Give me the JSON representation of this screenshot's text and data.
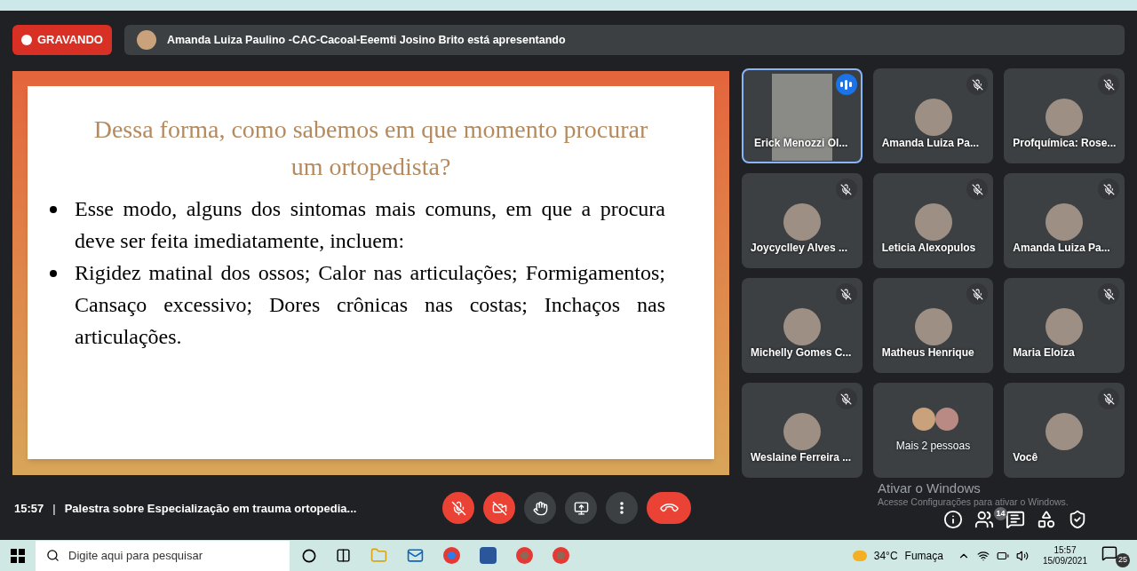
{
  "recording": {
    "label": "GRAVANDO",
    "on": true
  },
  "presenter_banner": {
    "text": "Amanda Luiza Paulino -CAC-Cacoal-Eeemti Josino Brito está apresentando"
  },
  "slide": {
    "title": "Dessa forma, como sabemos em que momento procurar um ortopedista?",
    "bullets": [
      "Esse modo, alguns dos sintomas mais comuns, em que a procura deve ser feita imediatamente, incluem:",
      "Rigidez matinal dos ossos; Calor nas articulações; Formigamentos; Cansaço excessivo; Dores crônicas nas costas; Inchaços nas articulações."
    ]
  },
  "participants": [
    {
      "kind": "video",
      "name": "Erick Menozzi Ol...",
      "speaking": true,
      "muted": false
    },
    {
      "kind": "avatar",
      "name": "Amanda Luiza Pa...",
      "speaking": false,
      "muted": true
    },
    {
      "kind": "avatar",
      "name": "Profquímica: Rose...",
      "speaking": false,
      "muted": true
    },
    {
      "kind": "avatar",
      "name": "Joycyclley Alves ...",
      "speaking": false,
      "muted": true
    },
    {
      "kind": "avatar",
      "name": "Leticia Alexopulos",
      "speaking": false,
      "muted": true
    },
    {
      "kind": "avatar",
      "name": "Amanda Luiza Pa...",
      "speaking": false,
      "muted": true
    },
    {
      "kind": "avatar",
      "name": "Michelly Gomes C...",
      "speaking": false,
      "muted": true
    },
    {
      "kind": "avatar",
      "name": "Matheus Henrique",
      "speaking": false,
      "muted": true
    },
    {
      "kind": "avatar",
      "name": "Maria Eloiza",
      "speaking": false,
      "muted": true
    },
    {
      "kind": "avatar",
      "name": "Weslaine Ferreira ...",
      "speaking": false,
      "muted": true
    },
    {
      "kind": "more",
      "name": "Mais 2 pessoas",
      "speaking": false,
      "muted": false
    },
    {
      "kind": "avatar",
      "name": "Você",
      "speaking": false,
      "muted": true
    }
  ],
  "meeting": {
    "time": "15:57",
    "separator": "|",
    "title": "Palestra sobre Especialização em trauma ortopedia..."
  },
  "controls": {
    "mic_on": false,
    "camera_on": false
  },
  "people_count": "14",
  "windows_watermark": {
    "title": "Ativar o Windows",
    "subtitle": "Acesse Configurações para ativar o Windows."
  },
  "taskbar": {
    "search_placeholder": "Digite aqui para pesquisar",
    "weather": "34°C",
    "weather_label": "Fumaça",
    "clock_time": "15:57",
    "clock_date": "15/09/2021",
    "notifications": "25"
  }
}
